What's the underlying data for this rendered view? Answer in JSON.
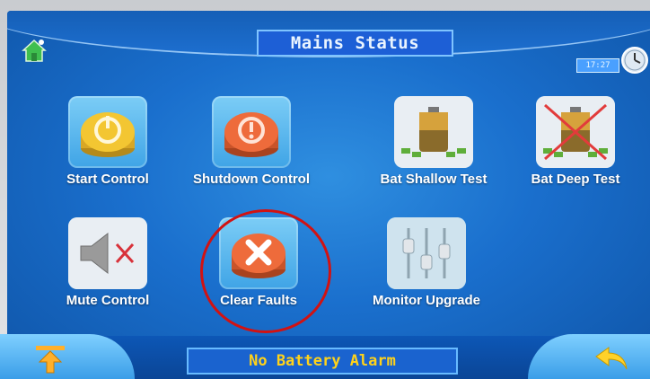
{
  "header": {
    "title": "Mains Status",
    "time": "17:27"
  },
  "icons": {
    "home": "home-icon",
    "clock": "clock-icon",
    "upload": "upload-arrow-icon",
    "back": "back-arrow-icon"
  },
  "controls": [
    {
      "id": "start-control",
      "label": "Start Control",
      "icon": "power-button-icon"
    },
    {
      "id": "shutdown-control",
      "label": "Shutdown Control",
      "icon": "shutdown-button-icon"
    },
    {
      "id": "bat-shallow-test",
      "label": "Bat Shallow Test",
      "icon": "battery-test-icon"
    },
    {
      "id": "bat-deep-test",
      "label": "Bat Deep Test",
      "icon": "battery-deep-test-icon"
    },
    {
      "id": "mute-control",
      "label": "Mute Control",
      "icon": "speaker-mute-icon"
    },
    {
      "id": "clear-faults",
      "label": "Clear Faults",
      "icon": "clear-x-button-icon"
    },
    {
      "id": "monitor-upgrade",
      "label": "Monitor Upgrade",
      "icon": "upgrade-sliders-icon"
    }
  ],
  "status": {
    "alarm_text": "No Battery Alarm"
  },
  "colors": {
    "screen_blue": "#1a6fcd",
    "status_text": "#ffd21a",
    "highlight_ring": "#d21212"
  }
}
